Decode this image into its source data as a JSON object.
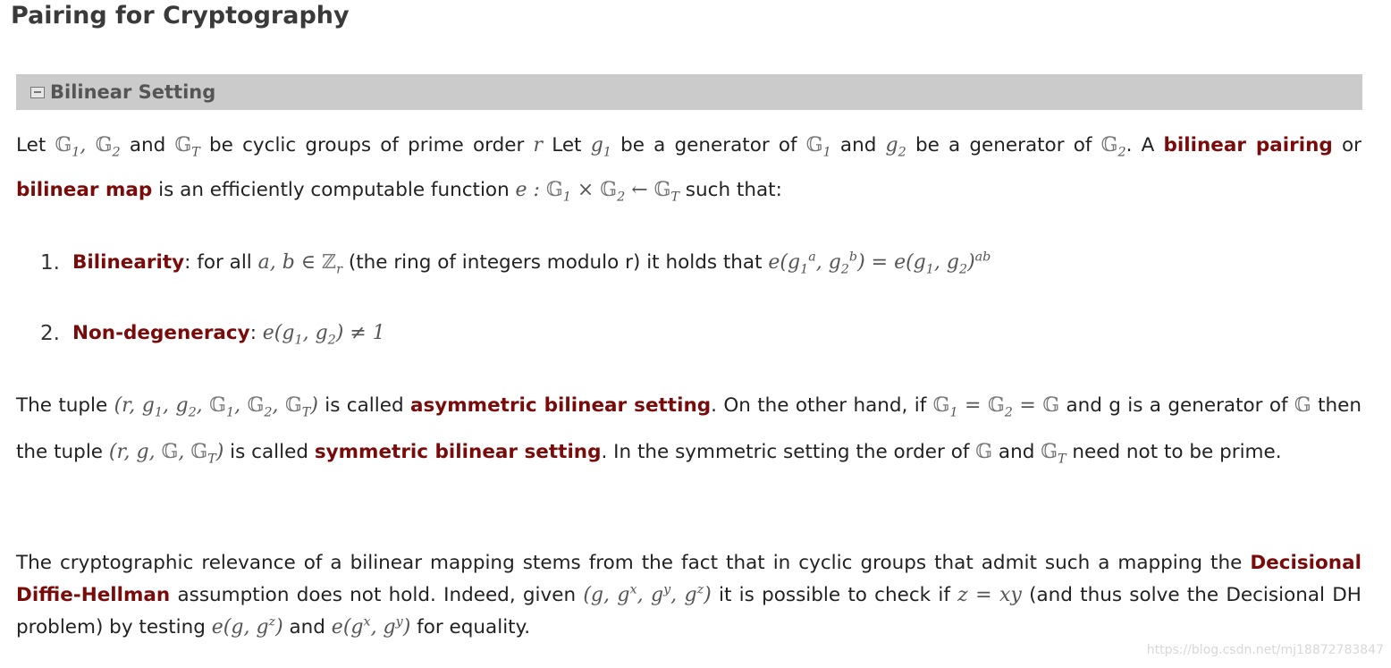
{
  "page": {
    "title": "Pairing for Cryptography",
    "section_title": "Bilinear Setting",
    "watermark": "https://blog.csdn.net/mj18872783847"
  },
  "para1": {
    "t1": "Let ",
    "t2": " and ",
    "t3": " be cyclic groups of prime order ",
    "t4": " Let ",
    "t5": " be a generator of ",
    "t6": " and ",
    "t7": " be a generator of ",
    "t8": ". A ",
    "term1": "bilinear pairing",
    "t9": " or ",
    "term2": "bilinear map",
    "t10": " is an efficiently computable function ",
    "t11": " such that:"
  },
  "list": {
    "items": [
      {
        "number": "1.",
        "term": "Bilinearity",
        "t1": ": for all ",
        "t2": " (the ring of integers modulo r) it holds that "
      },
      {
        "number": "2.",
        "term": "Non-degeneracy",
        "t1": ": "
      }
    ]
  },
  "para2": {
    "t1": "The tuple ",
    "t2": " is called ",
    "term1": "asymmetric bilinear setting",
    "t3": ". On the other hand, if ",
    "t4": " and g is a generator of ",
    "t5": " then the tuple ",
    "t6": " is called ",
    "term2": "symmetric bilinear setting",
    "t7": ". In the symmetric setting the order of ",
    "t8": " and ",
    "t9": " need not to be prime."
  },
  "para3": {
    "t1": "The cryptographic relevance of a bilinear mapping stems from the fact that in cyclic groups that admit such a mapping the ",
    "term1": "Decisional Diffie-Hellman",
    "t2": " assumption does not hold. Indeed, given ",
    "t3": " it is possible to check if ",
    "t4": " (and thus solve the Decisional DH problem) by testing ",
    "t5": " and ",
    "t6": " for equality."
  }
}
